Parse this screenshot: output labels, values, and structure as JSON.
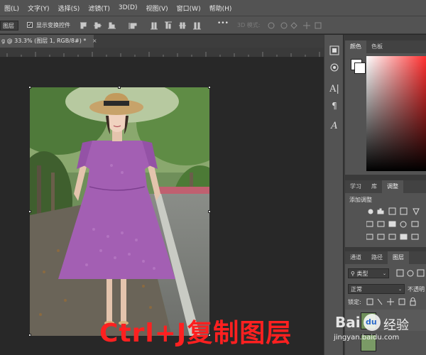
{
  "menu": [
    "图(L)",
    "文字(Y)",
    "选择(S)",
    "滤镜(T)",
    "3D(D)",
    "视图(V)",
    "窗口(W)",
    "帮助(H)"
  ],
  "options": {
    "auto_select_value": "图层",
    "show_transform_label": "显示变换控件",
    "mode_3d_label": "3D 模式:",
    "more": "•••"
  },
  "tab": {
    "title": "g @ 33.3% (图层 1, RGB/8#) *",
    "close": "×"
  },
  "color_panel": {
    "tabs": [
      "颜色",
      "色板"
    ]
  },
  "adjust_panel": {
    "tabs": [
      "学习",
      "库",
      "调整"
    ],
    "title": "添加调整"
  },
  "layers_panel": {
    "tabs": [
      "通道",
      "路径",
      "图层"
    ],
    "kind_label": "类型",
    "blend_mode": "正常",
    "opacity_label": "不透明",
    "lock_label": "锁定:"
  },
  "overlay": {
    "caption": "Ctrl+J复制图层",
    "watermark_top": "Bai",
    "watermark_logo_text": "du",
    "watermark_right": "经验",
    "watermark_url": "jingyan.baidu.com"
  },
  "colors": {
    "ui_bg": "#535353",
    "canvas_bg": "#282828",
    "dress": "#a35fb3",
    "caption_red": "#ff2020"
  }
}
